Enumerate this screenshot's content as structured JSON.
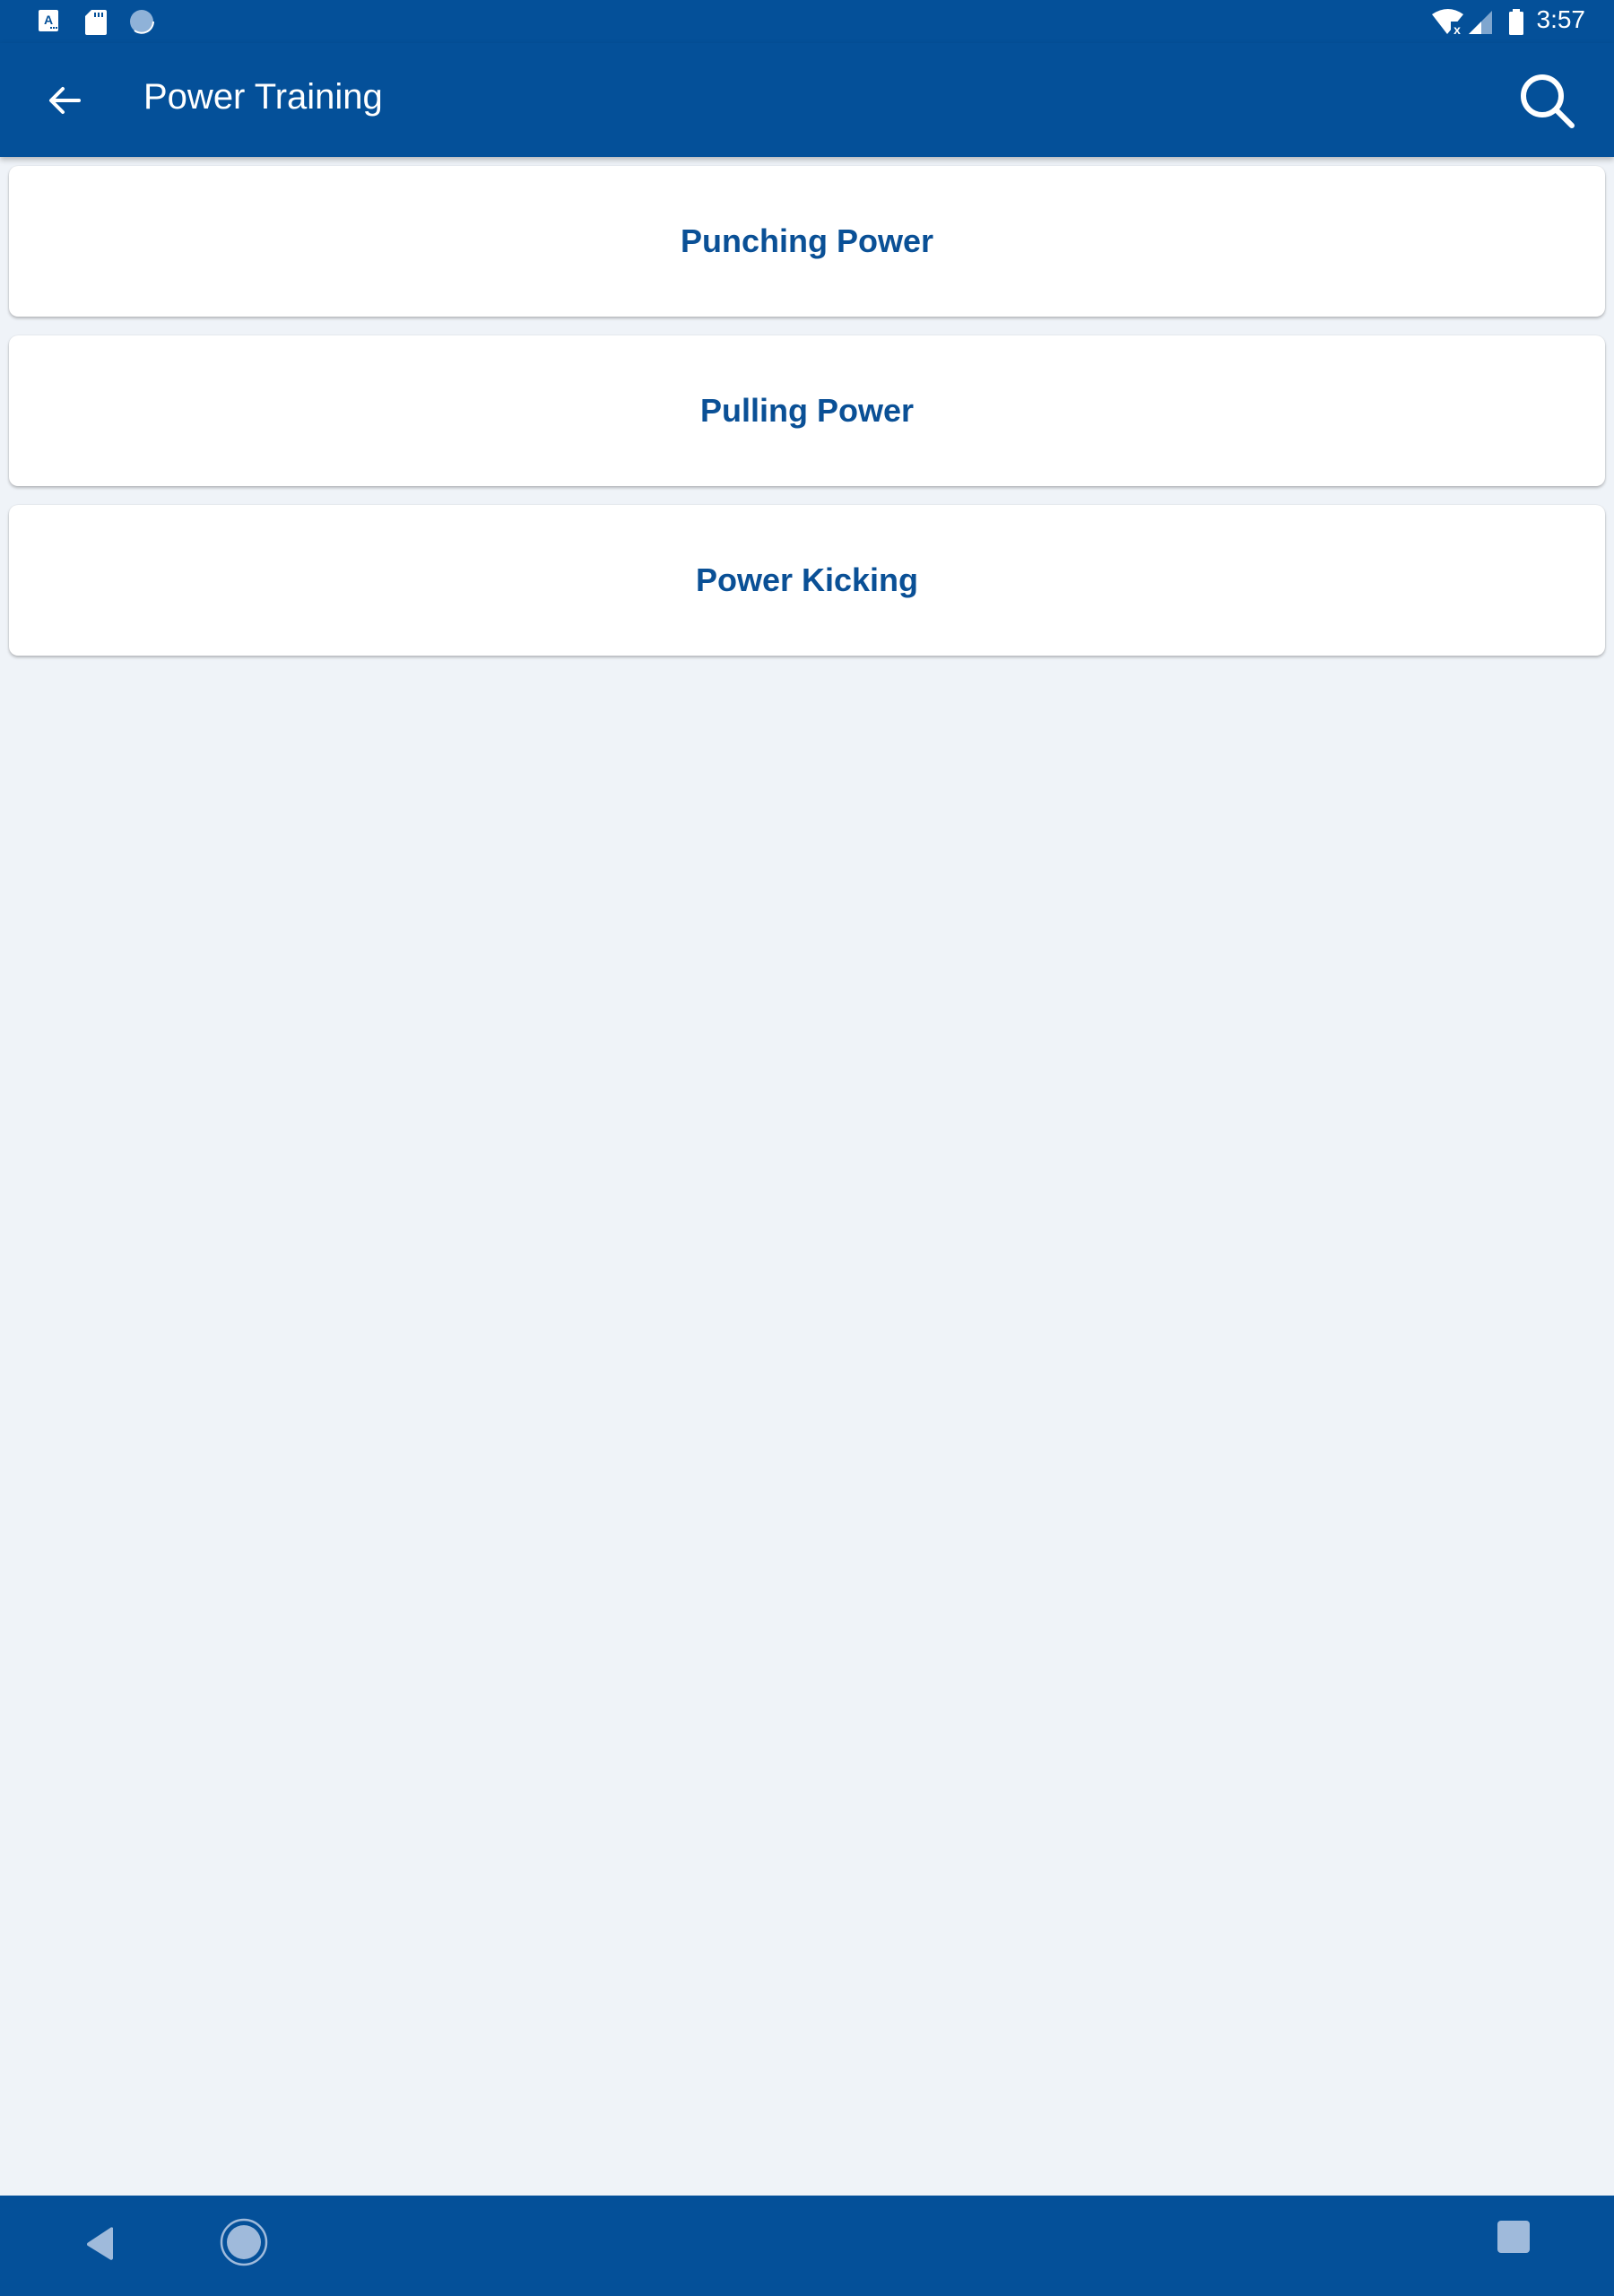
{
  "status_bar": {
    "left_icons": [
      "keyboard-a-icon",
      "sd-card-icon",
      "sync-circle-icon"
    ],
    "right_icons": [
      "wifi-no-internet-icon",
      "cell-signal-icon",
      "battery-icon"
    ],
    "time": "3:57"
  },
  "app_bar": {
    "title": "Power Training",
    "back_icon": "arrow-back-icon",
    "search_icon": "search-icon"
  },
  "list": {
    "items": [
      {
        "label": "Punching Power"
      },
      {
        "label": "Pulling Power"
      },
      {
        "label": "Power Kicking"
      }
    ]
  },
  "nav_bar": {
    "buttons": [
      "back-triangle-icon",
      "home-circle-icon",
      "recents-square-icon"
    ]
  },
  "colors": {
    "primary": "#045099",
    "background": "#eff3f8",
    "card": "#ffffff",
    "card_text": "#0a5096"
  }
}
